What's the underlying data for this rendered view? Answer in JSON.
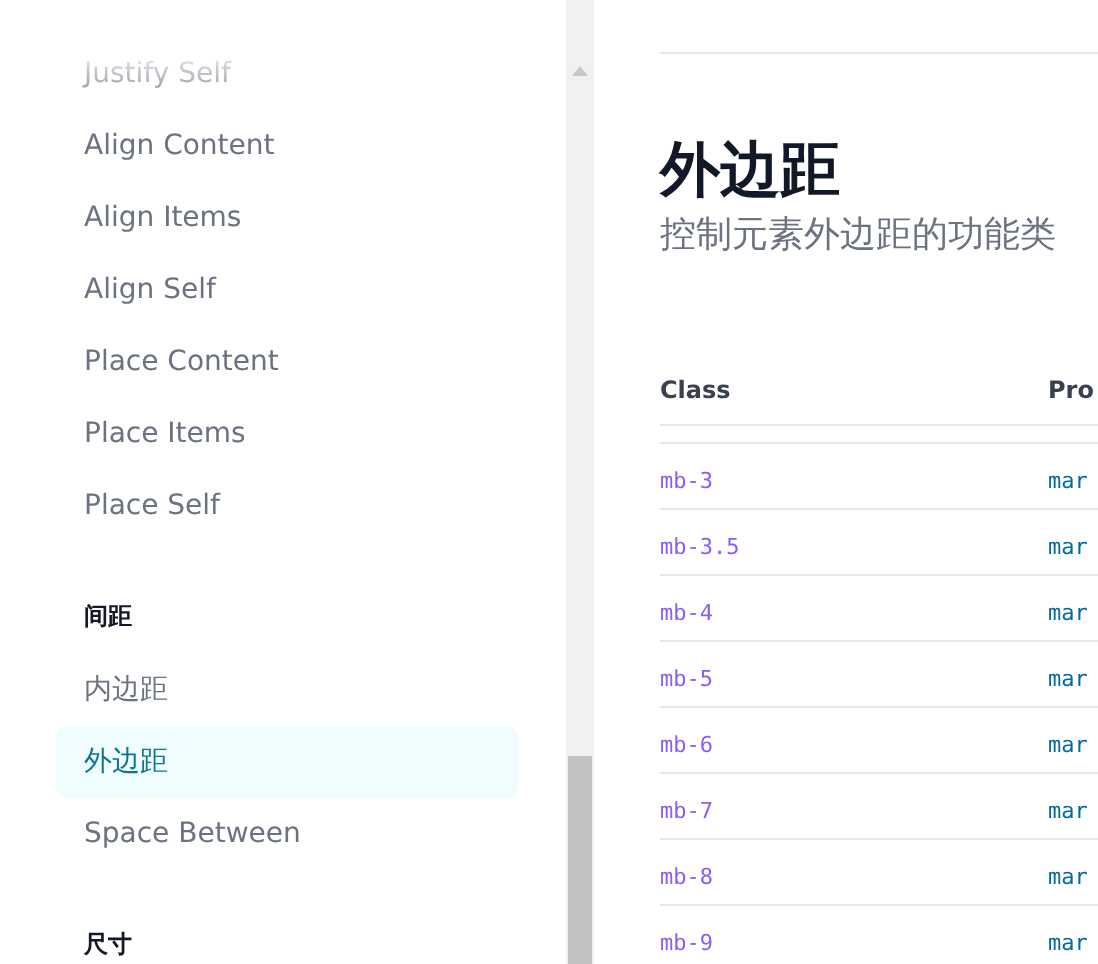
{
  "sidebar": {
    "sections": [
      {
        "items": [
          {
            "label": "Justify Self",
            "selected": false
          },
          {
            "label": "Align Content",
            "selected": false
          },
          {
            "label": "Align Items",
            "selected": false
          },
          {
            "label": "Align Self",
            "selected": false
          },
          {
            "label": "Place Content",
            "selected": false
          },
          {
            "label": "Place Items",
            "selected": false
          },
          {
            "label": "Place Self",
            "selected": false
          }
        ]
      },
      {
        "heading": "间距",
        "items": [
          {
            "label": "内边距",
            "selected": false
          },
          {
            "label": "外边距",
            "selected": true
          },
          {
            "label": "Space Between",
            "selected": false
          }
        ]
      },
      {
        "heading": "尺寸"
      }
    ]
  },
  "page": {
    "title": "外边距",
    "subtitle": "控制元素外边距的功能类"
  },
  "table": {
    "columns": [
      "Class",
      "Pro"
    ],
    "rows": [
      [
        "mb-3",
        "mar"
      ],
      [
        "mb-3.5",
        "mar"
      ],
      [
        "mb-4",
        "mar"
      ],
      [
        "mb-5",
        "mar"
      ],
      [
        "mb-6",
        "mar"
      ],
      [
        "mb-7",
        "mar"
      ],
      [
        "mb-8",
        "mar"
      ],
      [
        "mb-9",
        "mar"
      ]
    ]
  }
}
